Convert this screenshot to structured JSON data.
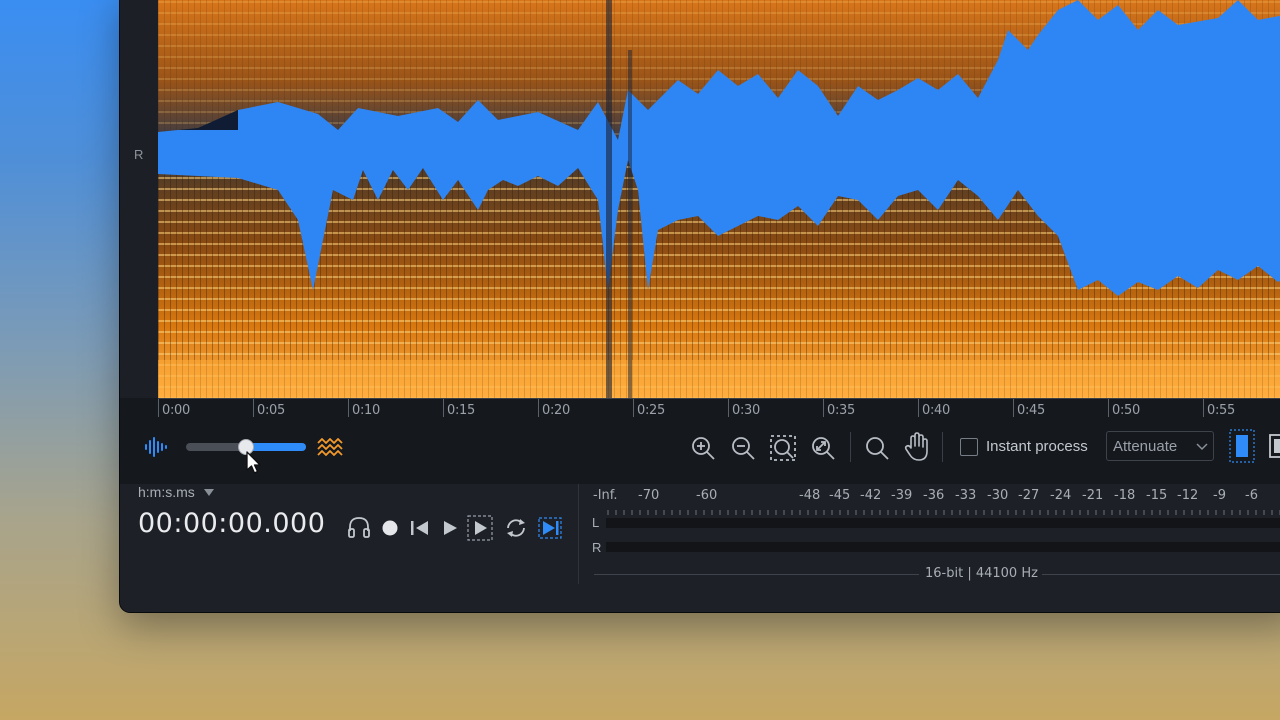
{
  "app": {
    "window": "iZotope RX spectrogram editor"
  },
  "channel": {
    "label": "R"
  },
  "timeline": {
    "labels": [
      "0:00",
      "0:05",
      "0:10",
      "0:15",
      "0:20",
      "0:25",
      "0:30",
      "0:35",
      "0:40",
      "0:45",
      "0:50",
      "0:55"
    ]
  },
  "view_slider": {
    "level": 0.5,
    "left_icon": "waveform-icon",
    "right_icon": "spectrogram-icon",
    "accent_color": "#2f8bf7"
  },
  "toolbar": {
    "icons": [
      "zoom-in-icon",
      "zoom-out-icon",
      "zoom-to-selection-icon",
      "zoom-to-fit-icon",
      "magnifier-tool-icon",
      "hand-tool-icon"
    ],
    "instant_process_label": "Instant process",
    "instant_process_checked": false,
    "mode_select_value": "Attenuate"
  },
  "transport": {
    "time_format": "h:m:s.ms",
    "timecode": "00:00:00.000",
    "buttons": [
      "headphones-icon",
      "record-icon",
      "skip-back-icon",
      "play-icon",
      "play-selection-icon",
      "loop-icon",
      "play-to-end-icon"
    ]
  },
  "meter": {
    "scale": [
      "-Inf.",
      "-70",
      "-60",
      "-48",
      "-45",
      "-42",
      "-39",
      "-36",
      "-33",
      "-30",
      "-27",
      "-24",
      "-21",
      "-18",
      "-15",
      "-12",
      "-9",
      "-6"
    ],
    "left_label": "L",
    "right_label": "R",
    "format": "16-bit | 44100 Hz"
  },
  "colors": {
    "spectrogram_background": "#2e86f5",
    "spectrogram_energy": "#f39a2c",
    "accent": "#2f8bf7"
  }
}
